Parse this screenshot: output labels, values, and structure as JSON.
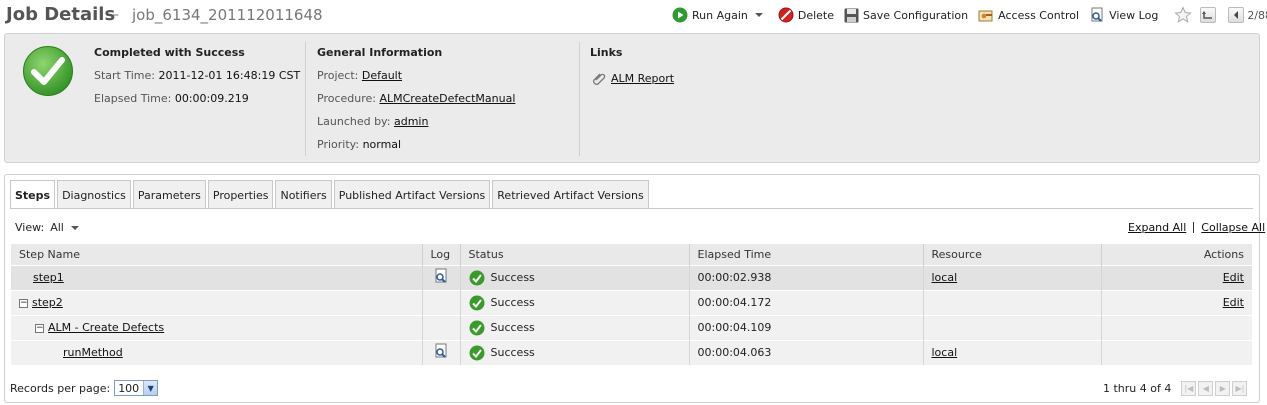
{
  "header": {
    "title": "Job Details",
    "separator": "–",
    "job_name": "job_6134_201112011648",
    "toolbar": {
      "run_again": "Run Again",
      "delete": "Delete",
      "save_configuration": "Save Configuration",
      "access_control": "Access Control",
      "view_log": "View Log",
      "position": "2/88"
    }
  },
  "summary": {
    "status": {
      "heading": "Completed with Success",
      "start_time_label": "Start Time:",
      "start_time": "2011-12-01 16:48:19 CST",
      "elapsed_time_label": "Elapsed Time:",
      "elapsed_time": "00:00:09.219"
    },
    "general": {
      "heading": "General Information",
      "project_label": "Project:",
      "project": "Default",
      "procedure_label": "Procedure:",
      "procedure": "ALMCreateDefectManual",
      "launched_by_label": "Launched by:",
      "launched_by": "admin",
      "priority_label": "Priority:",
      "priority": "normal"
    },
    "links": {
      "heading": "Links",
      "items": [
        "ALM Report"
      ]
    }
  },
  "tabs": [
    "Steps",
    "Diagnostics",
    "Parameters",
    "Properties",
    "Notifiers",
    "Published Artifact Versions",
    "Retrieved Artifact Versions"
  ],
  "view": {
    "label": "View:",
    "value": "All"
  },
  "expand_all": "Expand All",
  "collapse_all": "Collapse All",
  "table": {
    "columns": [
      "Step Name",
      "Log",
      "Status",
      "Elapsed Time",
      "Resource",
      "Actions"
    ],
    "rows": [
      {
        "name": "step1",
        "status": "Success",
        "elapsed": "00:00:02.938",
        "resource": "local",
        "action": "Edit"
      },
      {
        "name": "step2",
        "status": "Success",
        "elapsed": "00:00:04.172",
        "resource": "",
        "action": "Edit"
      },
      {
        "name": "ALM - Create Defects",
        "status": "Success",
        "elapsed": "00:00:04.109",
        "resource": "",
        "action": ""
      },
      {
        "name": "runMethod",
        "status": "Success",
        "elapsed": "00:00:04.063",
        "resource": "local",
        "action": ""
      }
    ]
  },
  "footer": {
    "records_label": "Records per page:",
    "records_value": "100",
    "range": "1 thru 4 of 4"
  },
  "colors": {
    "success": "#3a9a2c",
    "delete": "#d42020",
    "run": "#2f9a2f"
  }
}
